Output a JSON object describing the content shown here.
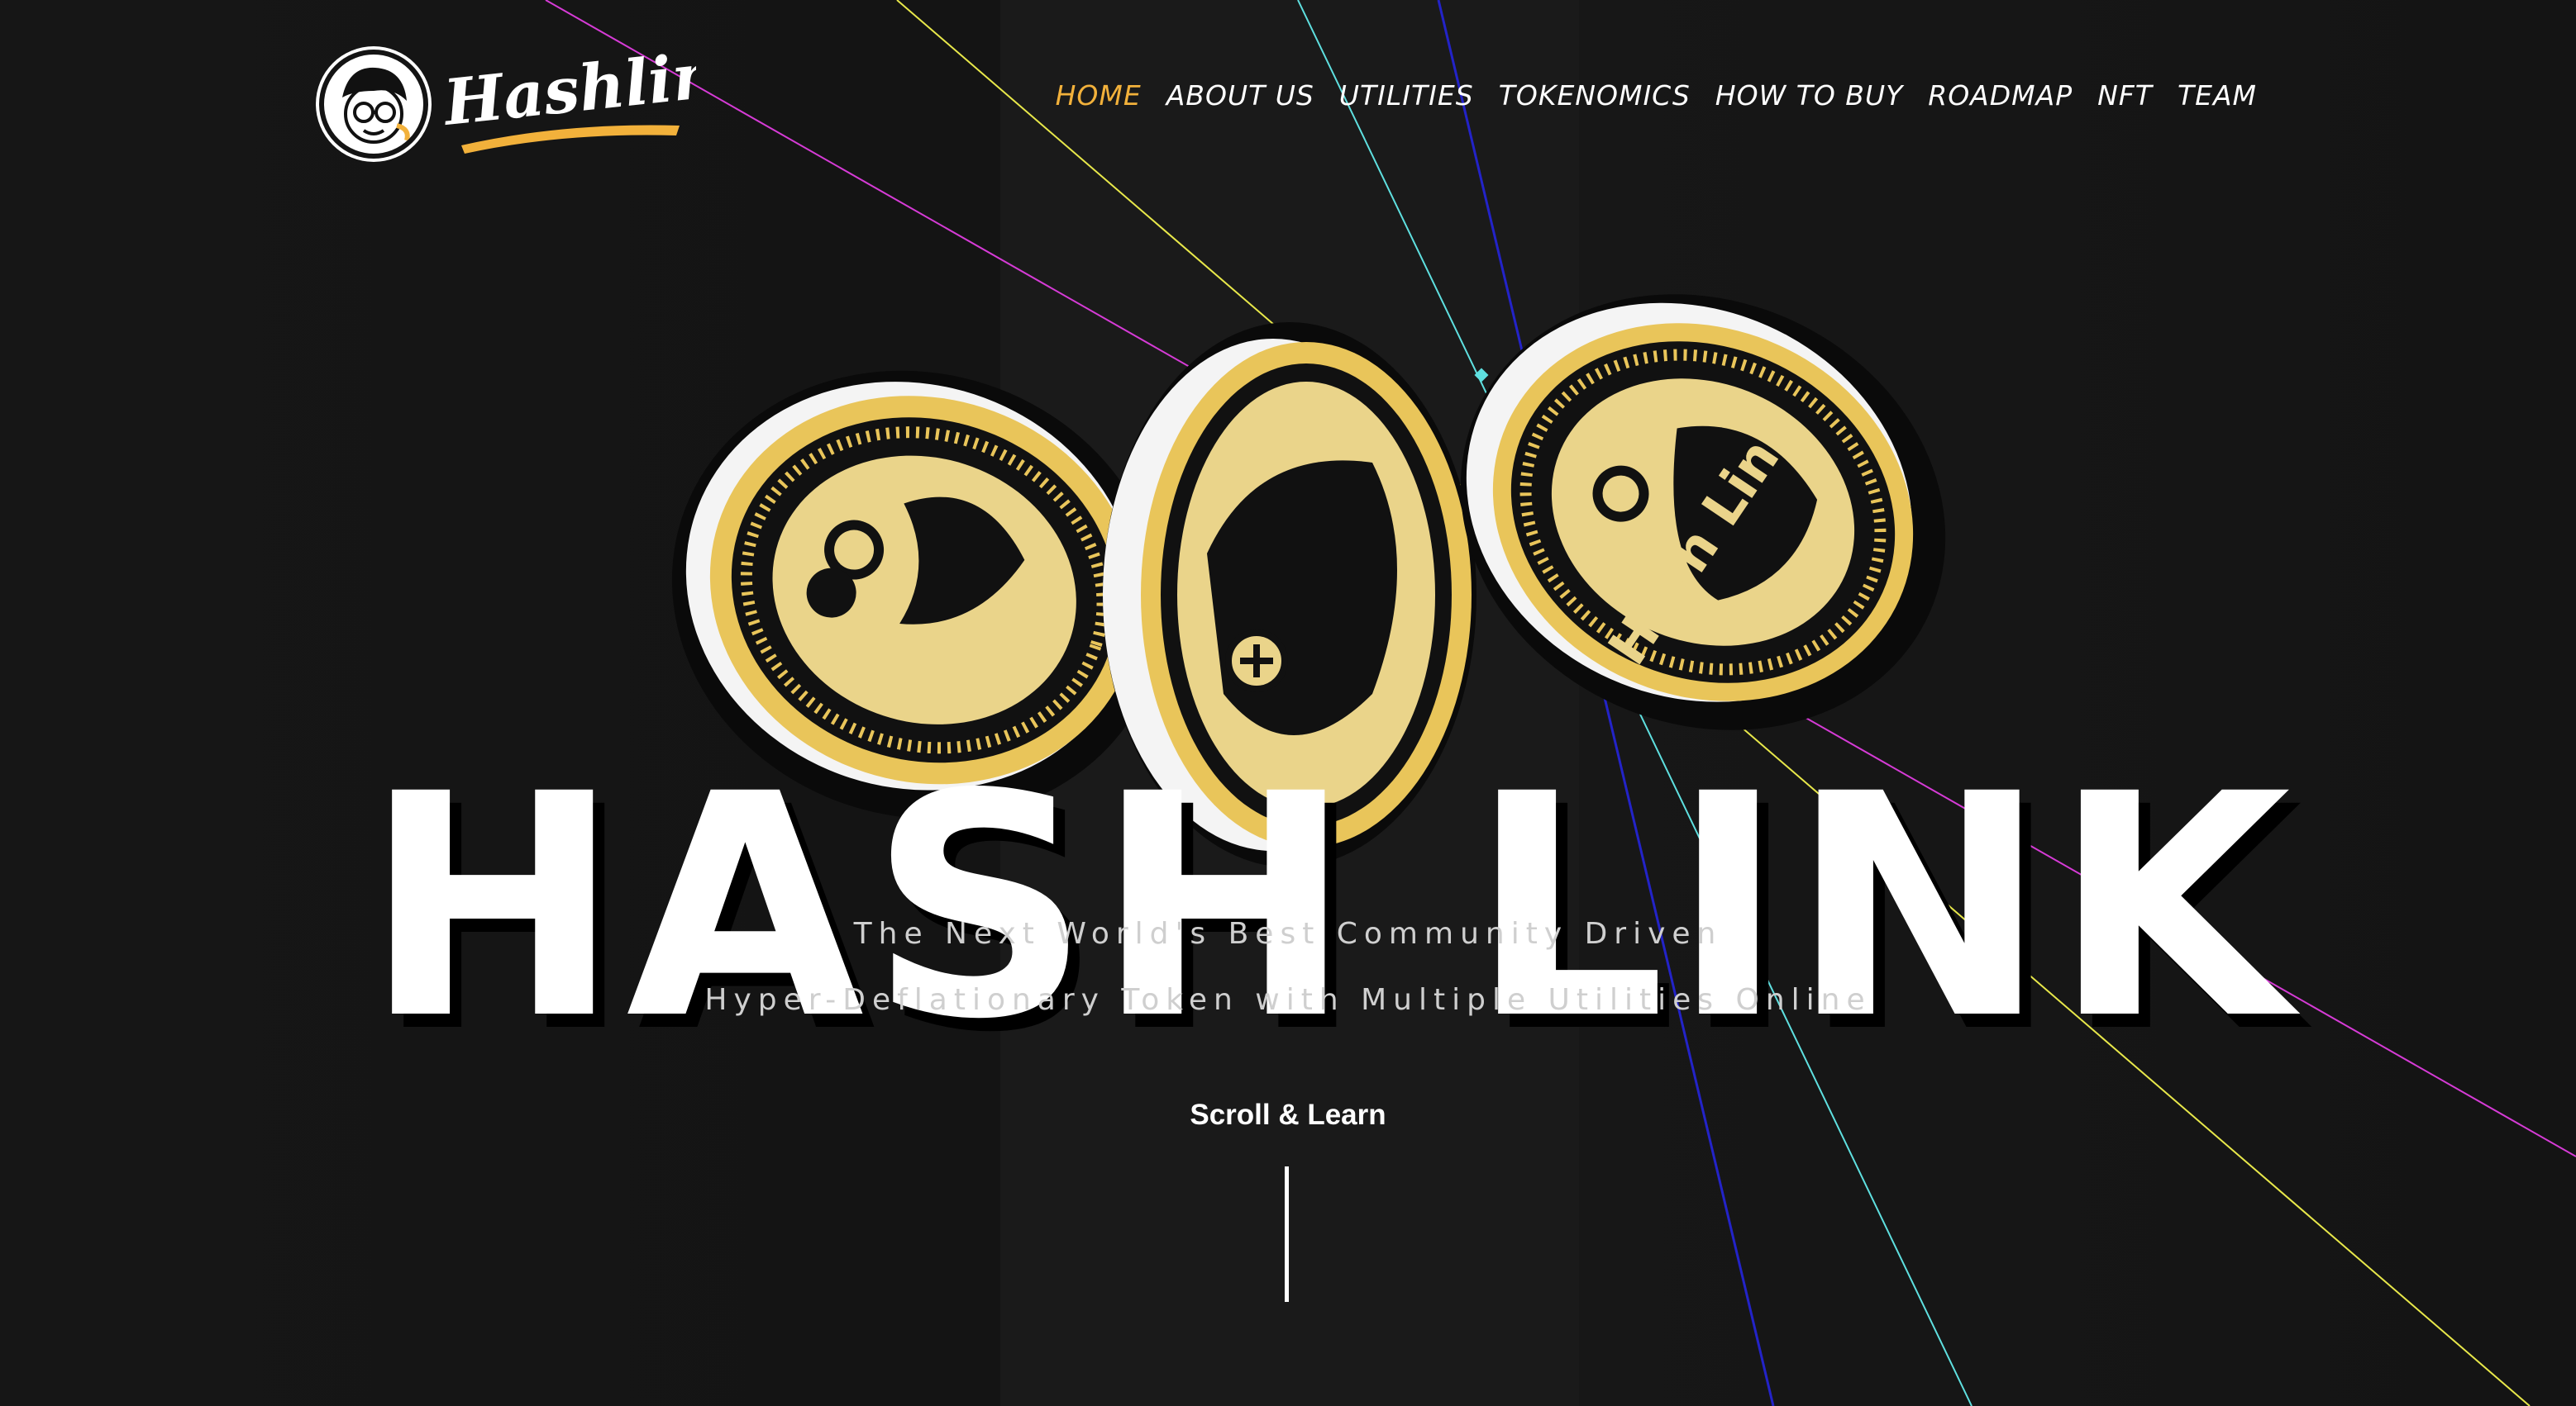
{
  "brand": {
    "logo_text": "Hashlink",
    "accent_color": "#f2b13b"
  },
  "nav": {
    "items": [
      {
        "label": "HOME",
        "active": true
      },
      {
        "label": "ABOUT US",
        "active": false
      },
      {
        "label": "UTILITIES",
        "active": false
      },
      {
        "label": "TOKENOMICS",
        "active": false
      },
      {
        "label": "HOW TO BUY",
        "active": false
      },
      {
        "label": "ROADMAP",
        "active": false
      },
      {
        "label": "NFT",
        "active": false
      },
      {
        "label": "TEAM",
        "active": false
      }
    ]
  },
  "hero": {
    "title": "HASH LINK",
    "coin_text": "Hash Link",
    "tagline_line1": "The Next World's Best Community Driven",
    "tagline_line2": "Hyper-Deflationary Token with Multiple Utilities Online",
    "scroll_label": "Scroll & Learn"
  },
  "decor": {
    "ray_colors": [
      "#d63bd6",
      "#e8e84a",
      "#5fe0e0",
      "#1a1ab8"
    ],
    "coin_gold": "#e9c55a",
    "background": "#141414"
  }
}
